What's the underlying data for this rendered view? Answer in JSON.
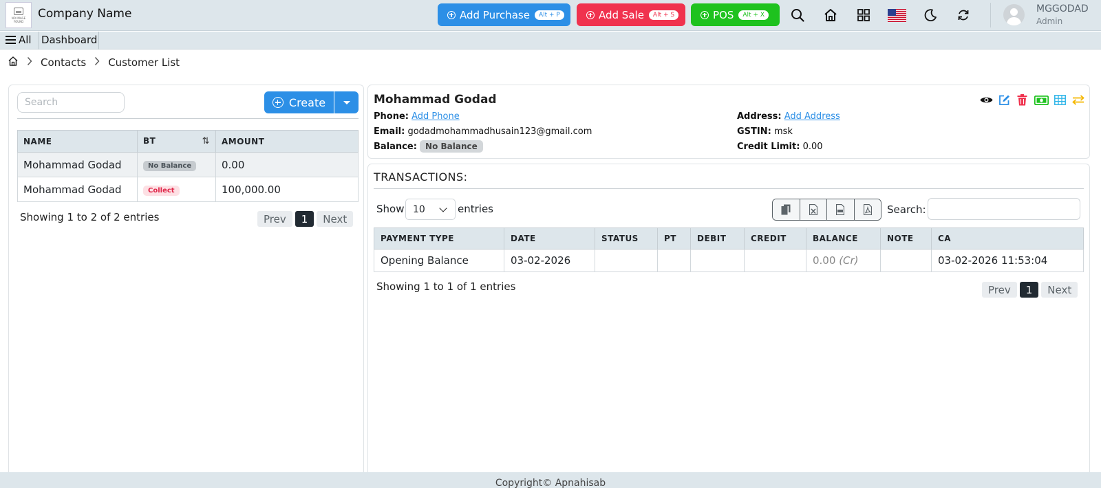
{
  "header": {
    "logo_text": "NO IMAGE FOUND",
    "company_name": "Company Name",
    "add_purchase": {
      "label": "Add Purchase",
      "shortcut": "Alt + P",
      "color": "#2c8fe6"
    },
    "add_sale": {
      "label": "Add Sale",
      "shortcut": "Alt + S",
      "color": "#f0324e"
    },
    "pos": {
      "label": "POS",
      "shortcut": "Alt + X",
      "color": "#1ec21e"
    },
    "icons": [
      "search-icon",
      "home-icon",
      "apps-grid-icon",
      "us-flag-icon",
      "moon-icon",
      "refresh-icon"
    ],
    "user": {
      "name": "MGGODAD",
      "role": "Admin"
    }
  },
  "subnav": {
    "all_label": "All",
    "dashboard_label": "Dashboard"
  },
  "breadcrumb": {
    "items": [
      "Contacts",
      "Customer List"
    ]
  },
  "customers": {
    "search_placeholder": "Search",
    "create_label": "Create",
    "columns": [
      "NAME",
      "BT",
      "AMOUNT"
    ],
    "rows": [
      {
        "name": "Mohammad Godad",
        "badge": "No Balance",
        "badge_type": "gray",
        "amount": "0.00"
      },
      {
        "name": "Mohammad Godad",
        "badge": "Collect",
        "badge_type": "red",
        "amount": "100,000.00"
      }
    ],
    "info": "Showing 1 to 2 of 2 entries",
    "pager": {
      "prev": "Prev",
      "page": "1",
      "next": "Next"
    }
  },
  "detail": {
    "name": "Mohammad Godad",
    "phone_label": "Phone:",
    "phone_link": "Add Phone",
    "email_label": "Email:",
    "email": "godadmohammadhusain123@gmail.com",
    "balance_label": "Balance:",
    "balance_badge": "No Balance",
    "address_label": "Address:",
    "address_link": "Add Address",
    "gstin_label": "GSTIN:",
    "gstin": "msk",
    "credit_label": "Credit Limit:",
    "credit_limit": "0.00",
    "action_icons": [
      "view-icon",
      "edit-icon",
      "delete-icon",
      "payment-icon",
      "ledger-grid-icon",
      "transfer-icon"
    ]
  },
  "transactions": {
    "title": "TRANSACTIONS:",
    "show_label": "Show",
    "page_size": "10",
    "entries_label": "entries",
    "export_icons": [
      "copy-icon",
      "excel-icon",
      "csv-icon",
      "pdf-icon"
    ],
    "search_label": "Search:",
    "columns": [
      "PAYMENT TYPE",
      "DATE",
      "STATUS",
      "PT",
      "DEBIT",
      "CREDIT",
      "BALANCE",
      "NOTE",
      "CA"
    ],
    "rows": [
      {
        "payment_type": "Opening Balance",
        "date": "03-02-2026",
        "status": "",
        "pt": "",
        "debit": "",
        "credit": "",
        "balance": "0.00",
        "balance_suffix": "(Cr)",
        "note": "",
        "ca": "03-02-2026 11:53:04"
      }
    ],
    "info": "Showing 1 to 1 of 1 entries",
    "pager": {
      "prev": "Prev",
      "page": "1",
      "next": "Next"
    }
  },
  "footer": {
    "text": "Copyright© Apnahisab"
  }
}
